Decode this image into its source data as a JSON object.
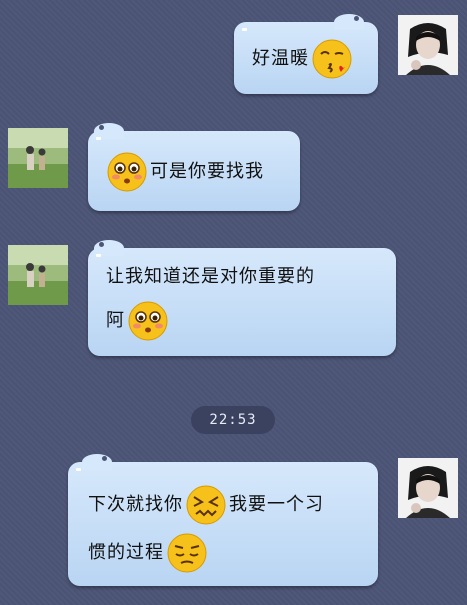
{
  "messages": [
    {
      "side": "out",
      "text_a": "好温暖",
      "emoji": "kiss-face-emoji"
    },
    {
      "side": "in",
      "text_a": "可是你要找我",
      "emoji": "blushing-face-emoji"
    },
    {
      "side": "in",
      "line1": "让我知道还是对你重要的",
      "line2": "阿",
      "emoji": "blushing-face-emoji"
    },
    {
      "side": "out",
      "line1_a": "下次就找你",
      "line1_b": "我要一个习",
      "line2": "惯的过程",
      "emoji_a": "confounded-face-emoji",
      "emoji_b": "pensive-face-emoji"
    }
  ],
  "timestamp": "22:53",
  "colors": {
    "background": "#4c5577",
    "bubble": "#c6def7",
    "timestamp_bg": "#3b4260"
  }
}
